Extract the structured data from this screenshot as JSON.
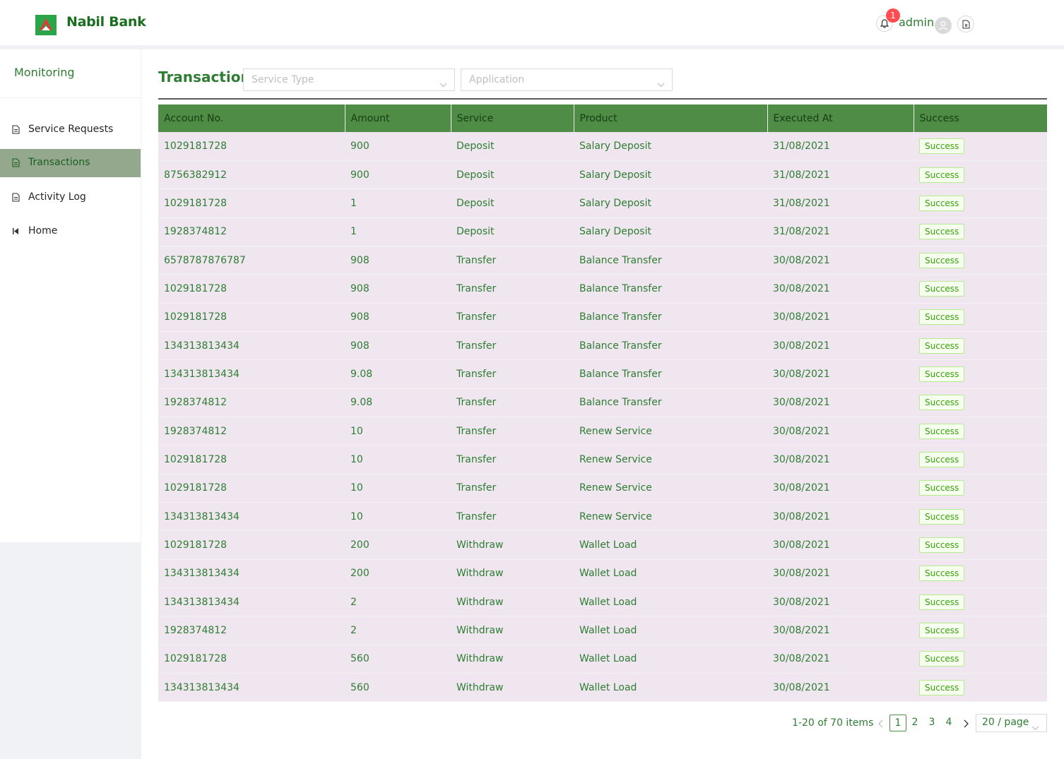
{
  "header": {
    "brand": "Nabil Bank",
    "notification_count": "1",
    "username": "admin"
  },
  "sidebar": {
    "section_title": "Monitoring",
    "items": [
      {
        "label": "Service Requests",
        "icon": "file-icon"
      },
      {
        "label": "Transactions",
        "icon": "file-icon"
      },
      {
        "label": "Activity Log",
        "icon": "file-icon"
      },
      {
        "label": "Home",
        "icon": "step-backward-icon"
      }
    ]
  },
  "page": {
    "title": "Transactions",
    "filters": {
      "service_type_placeholder": "Service Type",
      "application_placeholder": "Application"
    }
  },
  "table": {
    "columns": [
      "Account No.",
      "Amount",
      "Service",
      "Product",
      "Executed At",
      "Success"
    ],
    "rows": [
      [
        "1029181728",
        "900",
        "Deposit",
        "Salary Deposit",
        "31/08/2021",
        "Success"
      ],
      [
        "8756382912",
        "900",
        "Deposit",
        "Salary Deposit",
        "31/08/2021",
        "Success"
      ],
      [
        "1029181728",
        "1",
        "Deposit",
        "Salary Deposit",
        "31/08/2021",
        "Success"
      ],
      [
        "1928374812",
        "1",
        "Deposit",
        "Salary Deposit",
        "31/08/2021",
        "Success"
      ],
      [
        "6578787876787",
        "908",
        "Transfer",
        "Balance Transfer",
        "30/08/2021",
        "Success"
      ],
      [
        "1029181728",
        "908",
        "Transfer",
        "Balance Transfer",
        "30/08/2021",
        "Success"
      ],
      [
        "1029181728",
        "908",
        "Transfer",
        "Balance Transfer",
        "30/08/2021",
        "Success"
      ],
      [
        "134313813434",
        "908",
        "Transfer",
        "Balance Transfer",
        "30/08/2021",
        "Success"
      ],
      [
        "134313813434",
        "9.08",
        "Transfer",
        "Balance Transfer",
        "30/08/2021",
        "Success"
      ],
      [
        "1928374812",
        "9.08",
        "Transfer",
        "Balance Transfer",
        "30/08/2021",
        "Success"
      ],
      [
        "1928374812",
        "10",
        "Transfer",
        "Renew Service",
        "30/08/2021",
        "Success"
      ],
      [
        "1029181728",
        "10",
        "Transfer",
        "Renew Service",
        "30/08/2021",
        "Success"
      ],
      [
        "1029181728",
        "10",
        "Transfer",
        "Renew Service",
        "30/08/2021",
        "Success"
      ],
      [
        "134313813434",
        "10",
        "Transfer",
        "Renew Service",
        "30/08/2021",
        "Success"
      ],
      [
        "1029181728",
        "200",
        "Withdraw",
        "Wallet Load",
        "30/08/2021",
        "Success"
      ],
      [
        "134313813434",
        "200",
        "Withdraw",
        "Wallet Load",
        "30/08/2021",
        "Success"
      ],
      [
        "134313813434",
        "2",
        "Withdraw",
        "Wallet Load",
        "30/08/2021",
        "Success"
      ],
      [
        "1928374812",
        "2",
        "Withdraw",
        "Wallet Load",
        "30/08/2021",
        "Success"
      ],
      [
        "1029181728",
        "560",
        "Withdraw",
        "Wallet Load",
        "30/08/2021",
        "Success"
      ],
      [
        "134313813434",
        "560",
        "Withdraw",
        "Wallet Load",
        "30/08/2021",
        "Success"
      ]
    ]
  },
  "pagination": {
    "total_text": "1-20 of 70 items",
    "pages": [
      "1",
      "2",
      "3",
      "4"
    ],
    "current_page": "1",
    "page_size": "20 / page"
  },
  "colors": {
    "brand_green": "#2e7d32",
    "header_row": "#4f8d47",
    "row_bg": "#efe6f0",
    "active_menu": "#94a88e",
    "badge": "#ff4d4f"
  }
}
